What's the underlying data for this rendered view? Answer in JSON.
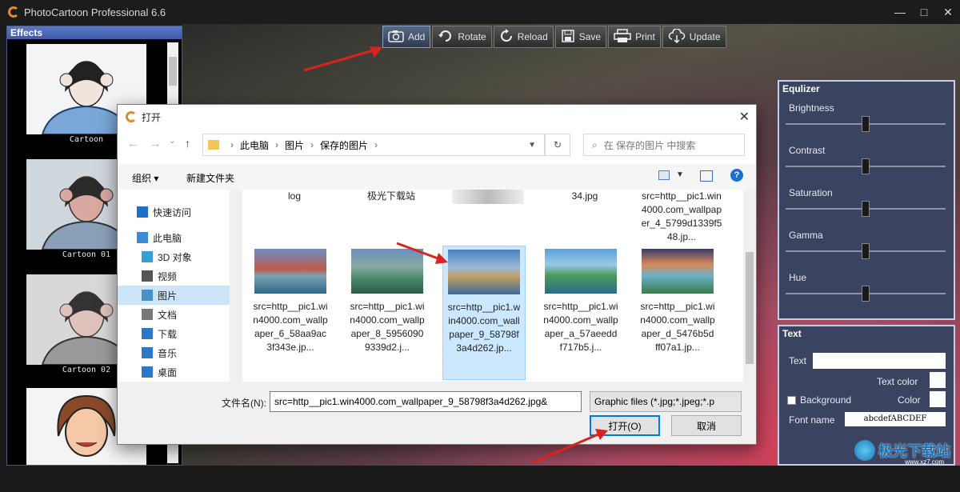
{
  "app": {
    "title": "PhotoCartoon Professional 6.6",
    "accent": "#e38a2a"
  },
  "window_controls": {
    "close": "✕",
    "maximize": "□",
    "minimize": "—"
  },
  "effects": {
    "header": "Effects",
    "items": [
      {
        "label": "Cartoon"
      },
      {
        "label": "Cartoon 01"
      },
      {
        "label": "Cartoon 02"
      },
      {
        "label": ""
      }
    ]
  },
  "toolbar": {
    "add": "Add",
    "rotate": "Rotate",
    "reload": "Reload",
    "save": "Save",
    "print": "Print",
    "update": "Update"
  },
  "equalizer": {
    "header": "Equlizer",
    "sliders": [
      {
        "label": "Brightness",
        "value": 0.5
      },
      {
        "label": "Contrast",
        "value": 0.5
      },
      {
        "label": "Saturation",
        "value": 0.5
      },
      {
        "label": "Gamma",
        "value": 0.5
      },
      {
        "label": "Hue",
        "value": 0.5
      }
    ]
  },
  "text_panel": {
    "header": "Text",
    "text_label": "Text",
    "text_color_label": "Text color",
    "background_label": "Background",
    "color_label": "Color",
    "font_name_label": "Font name",
    "font_sample": "abcdefABCDEF"
  },
  "watermark": {
    "text": "极光下载站",
    "sub": "www.xz7.com"
  },
  "dialog": {
    "title": "打开",
    "breadcrumb": [
      "此电脑",
      "图片",
      "保存的图片"
    ],
    "search_placeholder": "在 保存的图片 中搜索",
    "organize": "组织",
    "new_folder": "新建文件夹",
    "nav_items": [
      {
        "label": "快速访问",
        "icon": "star-icon"
      },
      {
        "label": "此电脑",
        "icon": "computer-icon"
      },
      {
        "label": "3D 对象",
        "icon": "cube-icon"
      },
      {
        "label": "视频",
        "icon": "video-icon"
      },
      {
        "label": "图片",
        "icon": "picture-icon"
      },
      {
        "label": "文档",
        "icon": "document-icon"
      },
      {
        "label": "下载",
        "icon": "download-icon"
      },
      {
        "label": "音乐",
        "icon": "music-icon"
      },
      {
        "label": "桌面",
        "icon": "desktop-icon"
      }
    ],
    "files_top": [
      {
        "name": "log"
      },
      {
        "name": "极光下载站"
      },
      {
        "name": ""
      },
      {
        "name": "34.jpg"
      },
      {
        "name": "src=http__pic1.win4000.com_wallpaper_4_5799d1339f548.jp..."
      }
    ],
    "files": [
      {
        "name": "src=http__pic1.win4000.com_wallpaper_6_58aa9ac3f343e.jp..."
      },
      {
        "name": "src=http__pic1.win4000.com_wallpaper_8_59560909339d2.j..."
      },
      {
        "name": "src=http__pic1.win4000.com_wallpaper_9_58798f3a4d262.jp..."
      },
      {
        "name": "src=http__pic1.win4000.com_wallpaper_a_57aeeddf717b5.j..."
      },
      {
        "name": "src=http__pic1.win4000.com_wallpaper_d_5476b5dff07a1.jp..."
      }
    ],
    "filename_label": "文件名(N):",
    "filename_value": "src=http__pic1.win4000.com_wallpaper_9_58798f3a4d262.jpg&",
    "filetype": "Graphic files (*.jpg;*.jpeg;*.p",
    "open_button": "打开(O)",
    "cancel_button": "取消"
  }
}
